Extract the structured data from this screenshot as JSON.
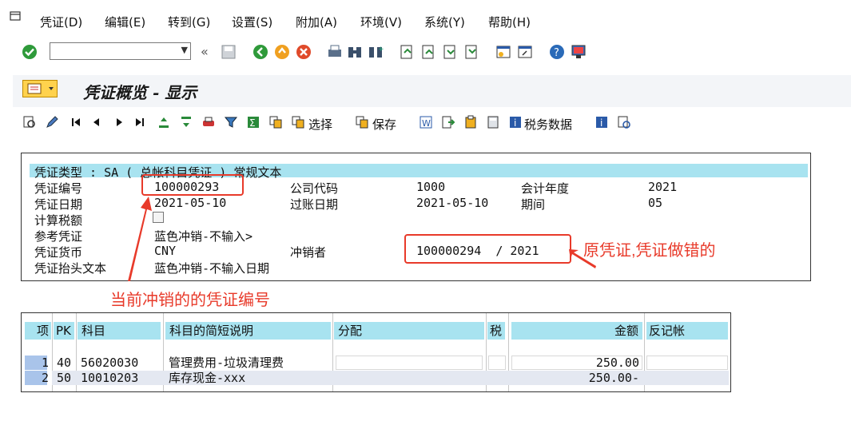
{
  "menu": {
    "items": [
      "凭证(D)",
      "编辑(E)",
      "转到(G)",
      "设置(S)",
      "附加(A)",
      "环境(V)",
      "系统(Y)",
      "帮助(H)"
    ]
  },
  "screen": {
    "title": "凭证概览 - 显示"
  },
  "toolbar2": {
    "select_label": "选择",
    "save_label": "保存",
    "tax_label": "税务数据"
  },
  "header": {
    "doc_type_line": "凭证类型 : SA ( 总帐科目凭证 ) 常规文本",
    "doc_no_label": "凭证编号",
    "doc_no": "100000293",
    "company_code_label": "公司代码",
    "company_code": "1000",
    "fiscal_year_label": "会计年度",
    "fiscal_year": "2021",
    "doc_date_label": "凭证日期",
    "doc_date": "2021-05-10",
    "posting_date_label": "过账日期",
    "posting_date": "2021-05-10",
    "period_label": "期间",
    "period": "05",
    "calc_tax_label": "计算税额",
    "reference_label": "参考凭证",
    "reference": "蓝色冲销-不输入>",
    "currency_label": "凭证货币",
    "currency": "CNY",
    "reversed_by_label": "冲销者",
    "reversed_by": "100000294  / 2021",
    "header_text_label": "凭证抬头文本",
    "header_text": "蓝色冲销-不输入日期"
  },
  "annotations": {
    "original_doc": "原凭证,凭证做错的",
    "current_doc": "当前冲销的的凭证编号"
  },
  "grid": {
    "columns": [
      "项",
      "PK",
      "科目",
      "科目的简短说明",
      "分配",
      "税",
      "金额",
      "反记帐"
    ],
    "rows": [
      {
        "item": "1",
        "pk": "40",
        "account": "56020030",
        "desc": "管理费用-垃圾清理费",
        "assignment": "",
        "tax": "",
        "amount": "250.00",
        "reverse": ""
      },
      {
        "item": "2",
        "pk": "50",
        "account": "10010203",
        "desc": "库存现金-xxx",
        "assignment": "",
        "tax": "",
        "amount": "250.00-",
        "reverse": ""
      }
    ]
  },
  "colors": {
    "highlight": "#a8e3f0",
    "annotation": "#e83a2a",
    "selection": "#a9c4ea"
  }
}
